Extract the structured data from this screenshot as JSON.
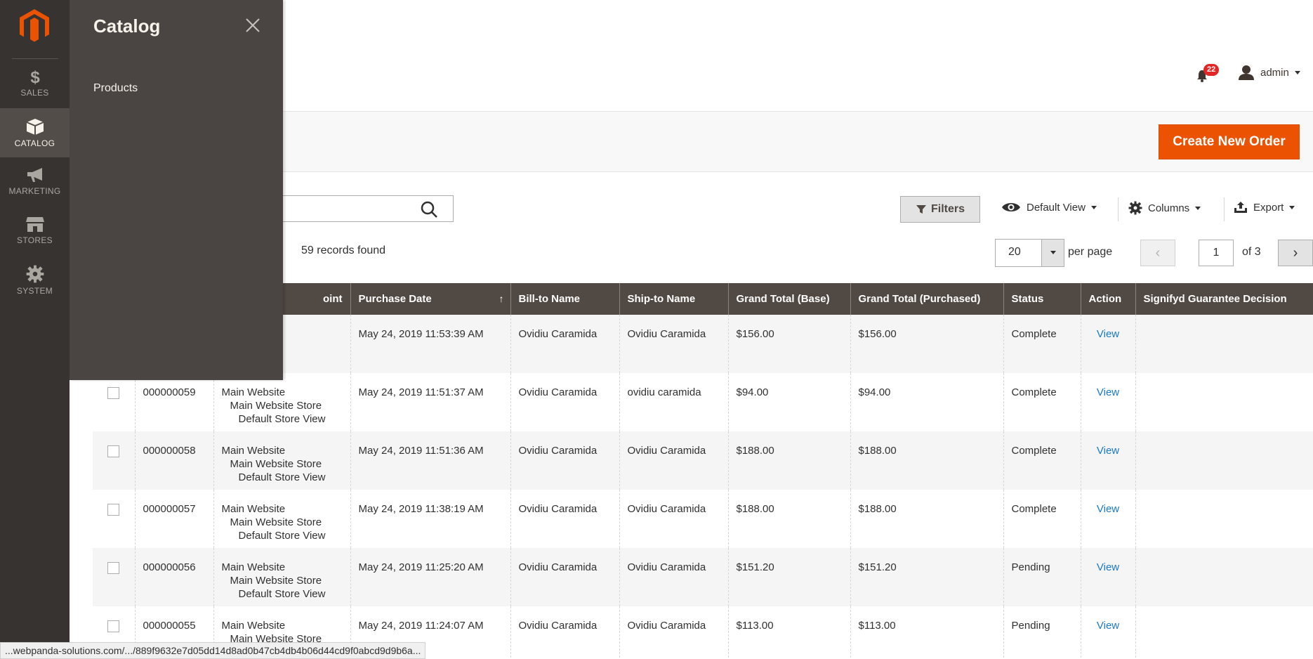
{
  "menu": {
    "items": [
      {
        "label": "SALES",
        "icon": "dollar-icon"
      },
      {
        "label": "CATALOG",
        "icon": "box-icon"
      },
      {
        "label": "MARKETING",
        "icon": "megaphone-icon"
      },
      {
        "label": "STORES",
        "icon": "store-icon"
      },
      {
        "label": "SYSTEM",
        "icon": "gear-icon"
      }
    ]
  },
  "flyout": {
    "title": "Catalog",
    "link": "Products"
  },
  "header": {
    "notifications_count": "22",
    "user": "admin"
  },
  "actions": {
    "create_label": "Create New Order"
  },
  "toolbar": {
    "filters_label": "Filters",
    "view_label": "Default View",
    "columns_label": "Columns",
    "export_label": "Export",
    "records_found": "59 records found",
    "per_page_value": "20",
    "per_page_label": "per page",
    "page_value": "1",
    "page_of": "of 3"
  },
  "grid": {
    "headers": [
      "oint",
      "Purchase Date",
      "Bill-to Name",
      "Ship-to Name",
      "Grand Total (Base)",
      "Grand Total (Purchased)",
      "Status",
      "Action",
      "Signifyd Guarantee Decision"
    ],
    "rows": [
      {
        "id": "",
        "pp1": "e",
        "pp2": "ite Store",
        "pp3": "ore View",
        "date": "May 24, 2019 11:53:39 AM",
        "bill": "Ovidiu Caramida",
        "ship": "Ovidiu Caramida",
        "base": "$156.00",
        "purchased": "$156.00",
        "status": "Complete",
        "action": "View"
      },
      {
        "id": "000000059",
        "pp1": "Main Website",
        "pp2": "Main Website Store",
        "pp3": "Default Store View",
        "date": "May 24, 2019 11:51:37 AM",
        "bill": "Ovidiu Caramida",
        "ship": "ovidiu caramida",
        "base": "$94.00",
        "purchased": "$94.00",
        "status": "Complete",
        "action": "View"
      },
      {
        "id": "000000058",
        "pp1": "Main Website",
        "pp2": "Main Website Store",
        "pp3": "Default Store View",
        "date": "May 24, 2019 11:51:36 AM",
        "bill": "Ovidiu Caramida",
        "ship": "Ovidiu Caramida",
        "base": "$188.00",
        "purchased": "$188.00",
        "status": "Complete",
        "action": "View"
      },
      {
        "id": "000000057",
        "pp1": "Main Website",
        "pp2": "Main Website Store",
        "pp3": "Default Store View",
        "date": "May 24, 2019 11:38:19 AM",
        "bill": "Ovidiu Caramida",
        "ship": "Ovidiu Caramida",
        "base": "$188.00",
        "purchased": "$188.00",
        "status": "Complete",
        "action": "View"
      },
      {
        "id": "000000056",
        "pp1": "Main Website",
        "pp2": "Main Website Store",
        "pp3": "Default Store View",
        "date": "May 24, 2019 11:25:20 AM",
        "bill": "Ovidiu Caramida",
        "ship": "Ovidiu Caramida",
        "base": "$151.20",
        "purchased": "$151.20",
        "status": "Pending",
        "action": "View"
      },
      {
        "id": "000000055",
        "pp1": "Main Website",
        "pp2": "Main Website Store",
        "pp3": "",
        "date": "May 24, 2019 11:24:07 AM",
        "bill": "Ovidiu Caramida",
        "ship": "Ovidiu Caramida",
        "base": "$113.00",
        "purchased": "$113.00",
        "status": "Pending",
        "action": "View"
      }
    ]
  },
  "statusbar": {
    "url": "...webpanda-solutions.com/.../889f9632e7d05dd14d8ad0b47cb4db4b06d44cd9f0abcd9d9b6a..."
  },
  "colors": {
    "menu_bg": "#373330",
    "flyout_bg": "#4a4542",
    "accent": "#eb5202",
    "table_header": "#514943",
    "link": "#1979c3"
  }
}
